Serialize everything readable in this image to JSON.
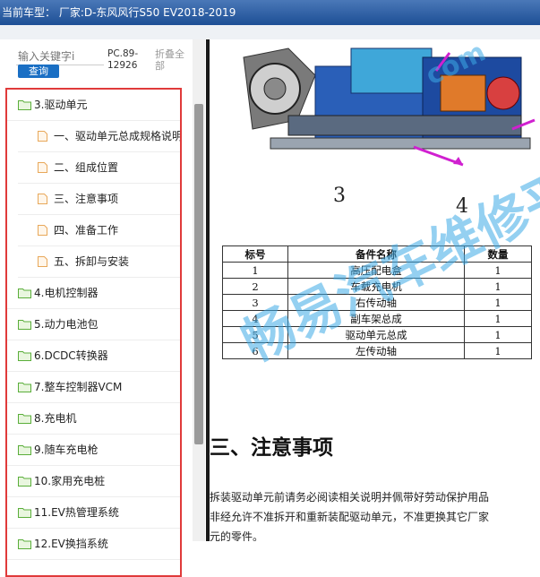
{
  "window": {
    "title": "当前车型：  厂家:D-东风风行S50 EV2018-2019"
  },
  "search": {
    "placeholder": "输入关键字i",
    "button_label": "查询",
    "pc_code": "PC.89-12926",
    "collapse_label": "折叠全部"
  },
  "tree": {
    "items": [
      {
        "label": "3.驱动单元",
        "type": "folder",
        "level": 0,
        "expanded": true
      },
      {
        "label": "一、驱动单元总成规格说明",
        "type": "page",
        "level": 1
      },
      {
        "label": "二、组成位置",
        "type": "page",
        "level": 1
      },
      {
        "label": "三、注意事项",
        "type": "page",
        "level": 1
      },
      {
        "label": "四、准备工作",
        "type": "page",
        "level": 1
      },
      {
        "label": "五、拆卸与安装",
        "type": "page",
        "level": 1
      },
      {
        "label": "4.电机控制器",
        "type": "folder",
        "level": 0
      },
      {
        "label": "5.动力电池包",
        "type": "folder",
        "level": 0
      },
      {
        "label": "6.DCDC转换器",
        "type": "folder",
        "level": 0
      },
      {
        "label": "7.整车控制器VCM",
        "type": "folder",
        "level": 0
      },
      {
        "label": "8.充电机",
        "type": "folder",
        "level": 0
      },
      {
        "label": "9.随车充电枪",
        "type": "folder",
        "level": 0
      },
      {
        "label": "10.家用充电桩",
        "type": "folder",
        "level": 0
      },
      {
        "label": "11.EV热管理系统",
        "type": "folder",
        "level": 0
      },
      {
        "label": "12.EV换挡系统",
        "type": "folder",
        "level": 0
      }
    ]
  },
  "document": {
    "figure_labels": [
      "3",
      "4"
    ],
    "table": {
      "headers": [
        "标号",
        "备件名称",
        "数量"
      ],
      "rows": [
        [
          "1",
          "高压配电盒",
          "1"
        ],
        [
          "2",
          "车载充电机",
          "1"
        ],
        [
          "3",
          "右传动轴",
          "1"
        ],
        [
          "4",
          "副车架总成",
          "1"
        ],
        [
          "5",
          "驱动单元总成",
          "1"
        ],
        [
          "6",
          "左传动轴",
          "1"
        ]
      ]
    },
    "heading": "三、注意事项",
    "paragraph_lines": [
      "拆装驱动单元前请务必阅读相关说明并佩带好劳动保护用品",
      "非经允许不准拆开和重新装配驱动单元，不准更换其它厂家",
      "元的零件。"
    ]
  },
  "watermark": {
    "text": "畅易汽车维修平",
    "text2": "com"
  },
  "colors": {
    "titlebar": "#1d4f95",
    "button": "#1a6fc4",
    "highlight_box": "#e03a3a",
    "folder": "#5aae3a",
    "page_icon": "#e8a85a"
  }
}
